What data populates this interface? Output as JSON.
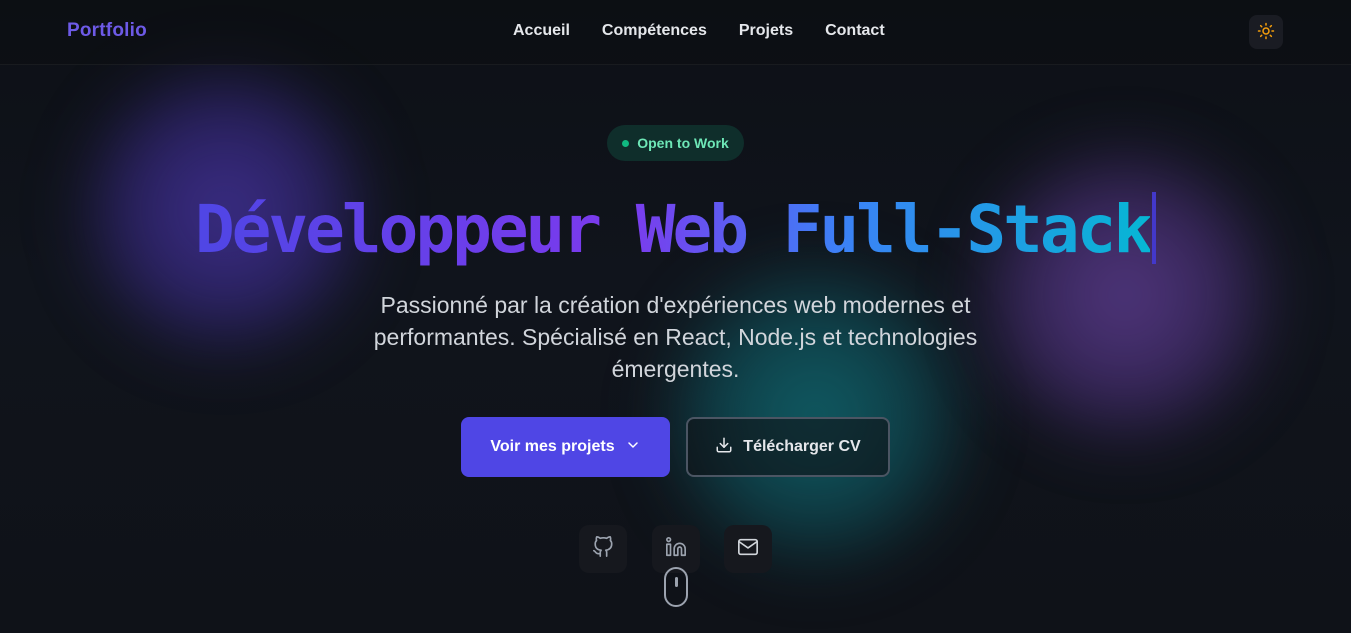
{
  "nav": {
    "brand": "Portfolio",
    "links": [
      "Accueil",
      "Compétences",
      "Projets",
      "Contact"
    ],
    "theme_toggle_icon": "sun-icon"
  },
  "hero": {
    "badge": "Open to Work",
    "headline": "Développeur Web Full-Stack",
    "subtitle": "Passionné par la création d'expériences web modernes et performantes. Spécialisé en React, Node.js et technologies émergentes.",
    "primary_button": "Voir mes projets",
    "secondary_button": "Télécharger CV"
  },
  "social": {
    "icons": [
      "github-icon",
      "linkedin-icon",
      "mail-icon"
    ]
  },
  "colors": {
    "brand": "#6d5ae6",
    "primary_button": "#4f46e5",
    "badge_dot": "#10b981",
    "badge_text": "#6ee7b7",
    "sun_icon": "#f59e0b"
  }
}
